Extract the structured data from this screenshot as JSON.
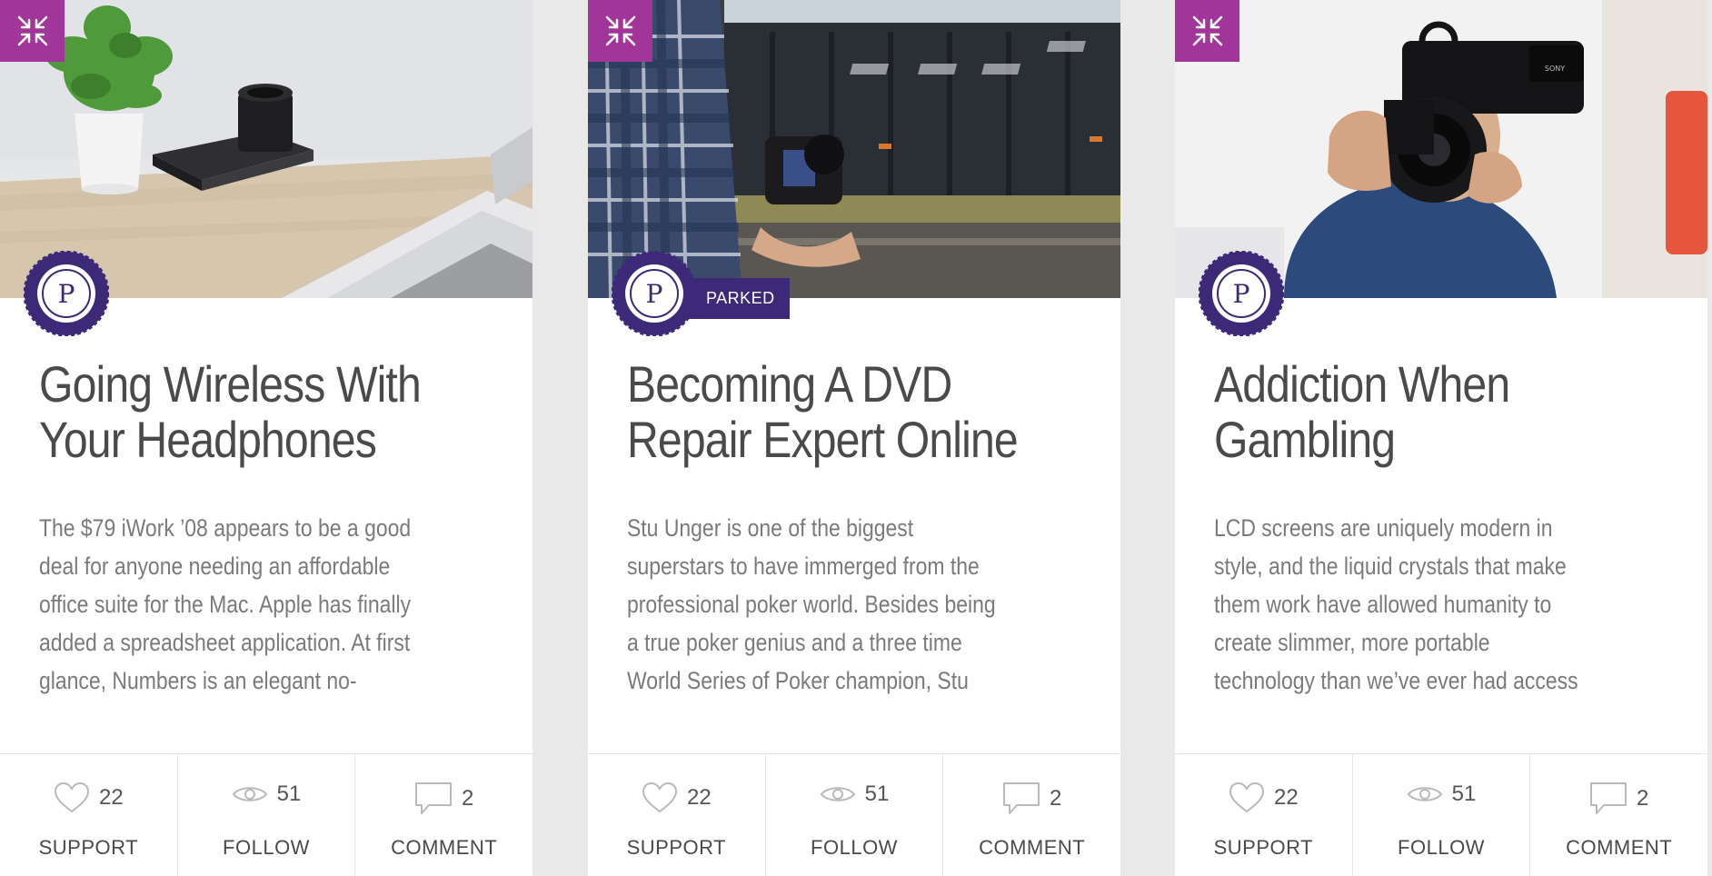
{
  "colors": {
    "accent": "#a1359a",
    "badge": "#3c2a78",
    "title": "#4a4a4a",
    "body": "#7a7a7a",
    "background": "#e9e9e9"
  },
  "badge_letter": "P",
  "cards": [
    {
      "image": "desk-with-plant-camera-laptop",
      "status": "",
      "title": "Going Wireless With\nYour Headphones",
      "excerpt": "The $79 iWork ’08 appears to be a good\ndeal for anyone needing an affordable\noffice suite for the Mac. Apple has finally\nadded a spreadsheet application. At first\nglance, Numbers is an elegant no-",
      "support_count": "22",
      "follow_count": "51",
      "comment_count": "2",
      "support_label": "SUPPORT",
      "follow_label": "FOLLOW",
      "comment_label": "COMMENT"
    },
    {
      "image": "man-holding-camera-by-train",
      "status": "PARKED",
      "title": "Becoming A DVD\nRepair Expert Online",
      "excerpt": "Stu Unger is one of the biggest\nsuperstars to have immerged from the\nprofessional poker world. Besides being\na true poker genius and a three time\nWorld Series of Poker champion, Stu",
      "support_count": "22",
      "follow_count": "51",
      "comment_count": "2",
      "support_label": "SUPPORT",
      "follow_label": "FOLLOW",
      "comment_label": "COMMENT"
    },
    {
      "image": "man-with-video-camera",
      "status": "",
      "title": "Addiction When\nGambling",
      "excerpt": "LCD screens are uniquely modern in\nstyle, and the liquid crystals that make\nthem work have allowed humanity to\ncreate slimmer, more portable\ntechnology than we’ve ever had access",
      "support_count": "22",
      "follow_count": "51",
      "comment_count": "2",
      "support_label": "SUPPORT",
      "follow_label": "FOLLOW",
      "comment_label": "COMMENT"
    }
  ]
}
